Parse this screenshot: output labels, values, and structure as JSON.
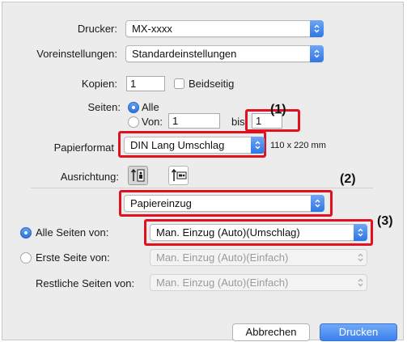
{
  "printer": {
    "label": "Drucker:",
    "value": "MX-xxxx"
  },
  "presets": {
    "label": "Voreinstellungen:",
    "value": "Standardeinstellungen"
  },
  "copies": {
    "label": "Kopien:",
    "value": "1",
    "duplex_label": "Beidseitig"
  },
  "pages": {
    "label": "Seiten:",
    "all_label": "Alle",
    "from_label": "Von:",
    "from_value": "1",
    "to_label": "bis:",
    "to_value": "1"
  },
  "paper": {
    "label": "Papierformat",
    "value": "DIN Lang Umschlag",
    "size_text": "110 x 220 mm"
  },
  "orientation": {
    "label": "Ausrichtung:"
  },
  "section": {
    "value": "Papiereinzug"
  },
  "paper_feed": {
    "all_pages_label": "Alle Seiten von:",
    "all_pages_value": "Man. Einzug (Auto)(Umschlag)",
    "first_page_label": "Erste Seite von:",
    "first_page_value": "Man. Einzug (Auto)(Einfach)",
    "remaining_label": "Restliche Seiten von:",
    "remaining_value": "Man. Einzug (Auto)(Einfach)"
  },
  "annotations": [
    "(1)",
    "(2)",
    "(3)"
  ],
  "buttons": {
    "cancel": "Abbrechen",
    "print": "Drucken"
  },
  "colors": {
    "accent": "#2f76e4",
    "highlight": "#e3101f"
  }
}
